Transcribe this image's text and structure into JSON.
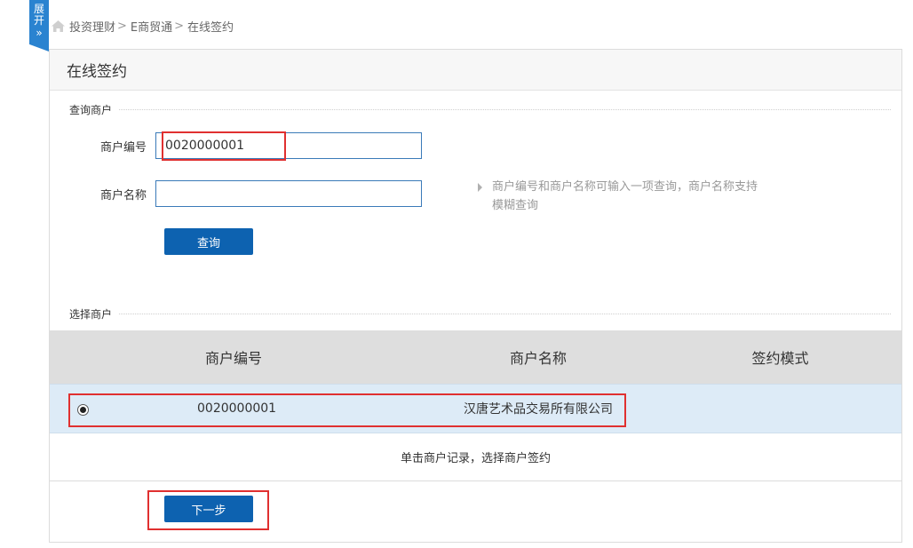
{
  "sidebar_toggle": {
    "label": "展开",
    "chevron": "»"
  },
  "breadcrumb": {
    "items": [
      "投资理财",
      "E商贸通"
    ],
    "separator": ">",
    "current": "在线签约"
  },
  "panel": {
    "title": "在线签约"
  },
  "query_section": {
    "title": "查询商户",
    "merchant_code_label": "商户编号",
    "merchant_code_value": "0020000001",
    "merchant_name_label": "商户名称",
    "merchant_name_value": "",
    "hint": "商户编号和商户名称可输入一项查询，商户名称支持模糊查询",
    "query_button": "查询"
  },
  "select_section": {
    "title": "选择商户",
    "columns": [
      "商户编号",
      "商户名称",
      "签约模式"
    ],
    "rows": [
      {
        "code": "0020000001",
        "name": "汉唐艺术品交易所有限公司",
        "mode": "",
        "selected": true
      }
    ],
    "note": "单击商户记录，选择商户签约"
  },
  "next_button": "下一步",
  "colors": {
    "primary_button": "#0d62b0",
    "highlight": "#e03030",
    "selected_row": "#ddebf7",
    "toggle_tab": "#2a83d0"
  }
}
